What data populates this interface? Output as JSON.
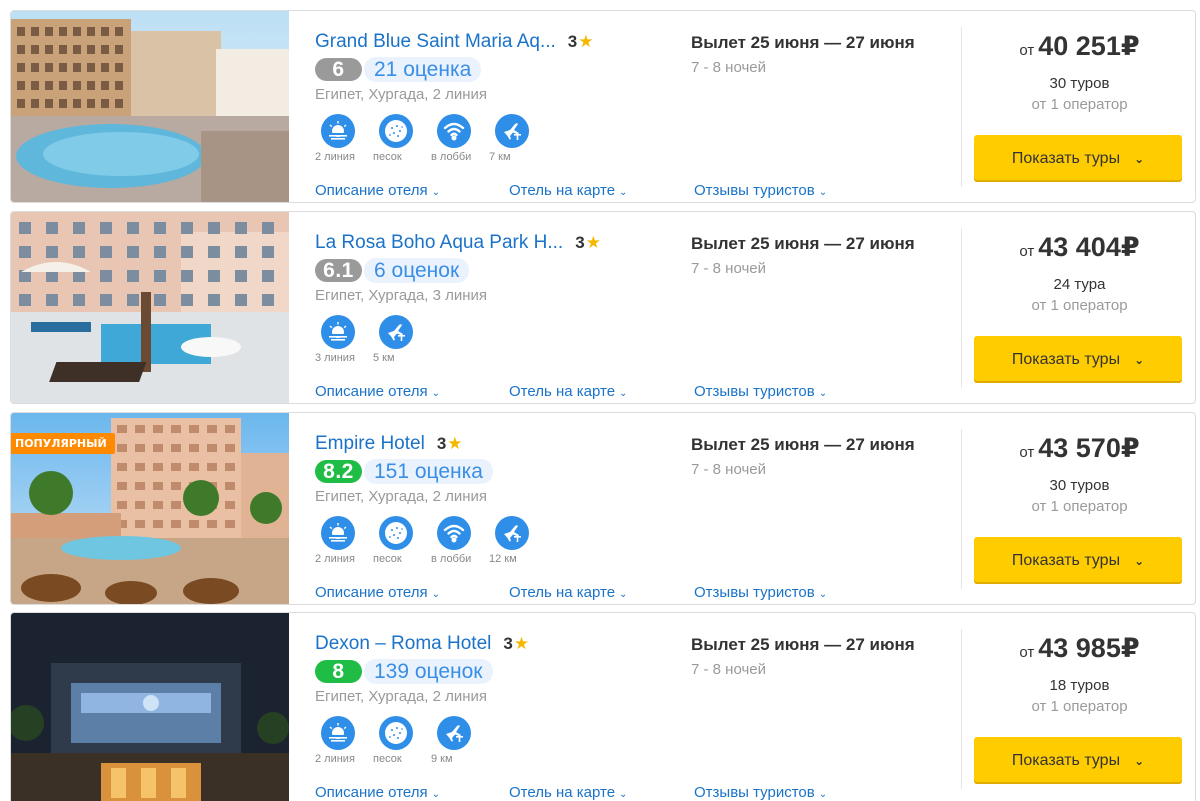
{
  "hotels": [
    {
      "name": "Grand Blue Saint Maria Aq...",
      "stars": "3",
      "score": "6",
      "score_color": "#9a9a9a",
      "reviews": "21 оценка",
      "location": "Египет, Хургада, 2 линия",
      "badge": "",
      "amenities": [
        {
          "icon": "beach-sunrise-icon",
          "label": "2 линия"
        },
        {
          "icon": "sand-icon",
          "label": "песок"
        },
        {
          "icon": "wifi-icon",
          "label": "в лобби"
        },
        {
          "icon": "airport-icon",
          "label": "7 км"
        }
      ],
      "dates": "Вылет 25 июня — 27 июня",
      "nights": "7 - 8 ночей",
      "price_from": "от",
      "price": "40 251₽",
      "tours": "30 туров",
      "operators": "от 1 оператор",
      "button": "Показать туры"
    },
    {
      "name": "La Rosa Boho Aqua Park H...",
      "stars": "3",
      "score": "6.1",
      "score_color": "#9a9a9a",
      "reviews": "6 оценок",
      "location": "Египет, Хургада, 3 линия",
      "badge": "",
      "amenities": [
        {
          "icon": "beach-sunrise-icon",
          "label": "3 линия"
        },
        {
          "icon": "airport-icon",
          "label": "5 км"
        }
      ],
      "dates": "Вылет 25 июня — 27 июня",
      "nights": "7 - 8 ночей",
      "price_from": "от",
      "price": "43 404₽",
      "tours": "24 тура",
      "operators": "от 1 оператор",
      "button": "Показать туры"
    },
    {
      "name": "Empire Hotel",
      "stars": "3",
      "score": "8.2",
      "score_color": "#1fbd45",
      "reviews": "151 оценка",
      "location": "Египет, Хургада, 2 линия",
      "badge": "ПОПУЛЯРНЫЙ",
      "amenities": [
        {
          "icon": "beach-sunrise-icon",
          "label": "2 линия"
        },
        {
          "icon": "sand-icon",
          "label": "песок"
        },
        {
          "icon": "wifi-icon",
          "label": "в лобби"
        },
        {
          "icon": "airport-icon",
          "label": "12 км"
        }
      ],
      "dates": "Вылет 25 июня — 27 июня",
      "nights": "7 - 8 ночей",
      "price_from": "от",
      "price": "43 570₽",
      "tours": "30 туров",
      "operators": "от 1 оператор",
      "button": "Показать туры"
    },
    {
      "name": "Dexon – Roma Hotel",
      "stars": "3",
      "score": "8",
      "score_color": "#1fbd45",
      "reviews": "139 оценок",
      "location": "Египет, Хургада, 2 линия",
      "badge": "",
      "amenities": [
        {
          "icon": "beach-sunrise-icon",
          "label": "2 линия"
        },
        {
          "icon": "sand-icon",
          "label": "песок"
        },
        {
          "icon": "airport-icon",
          "label": "9 км"
        }
      ],
      "dates": "Вылет 25 июня — 27 июня",
      "nights": "7 - 8 ночей",
      "price_from": "от",
      "price": "43 985₽",
      "tours": "18 туров",
      "operators": "от 1 оператор",
      "button": "Показать туры"
    }
  ],
  "links": {
    "description": "Описание отеля",
    "map": "Отель на карте",
    "reviews": "Отзывы туристов"
  },
  "colors": {
    "accent_blue": "#1a73c9",
    "icon_blue": "#2e8ee8",
    "button_yellow": "#ffcc00",
    "star_yellow": "#f5b800",
    "badge_orange": "#ff8a00"
  }
}
